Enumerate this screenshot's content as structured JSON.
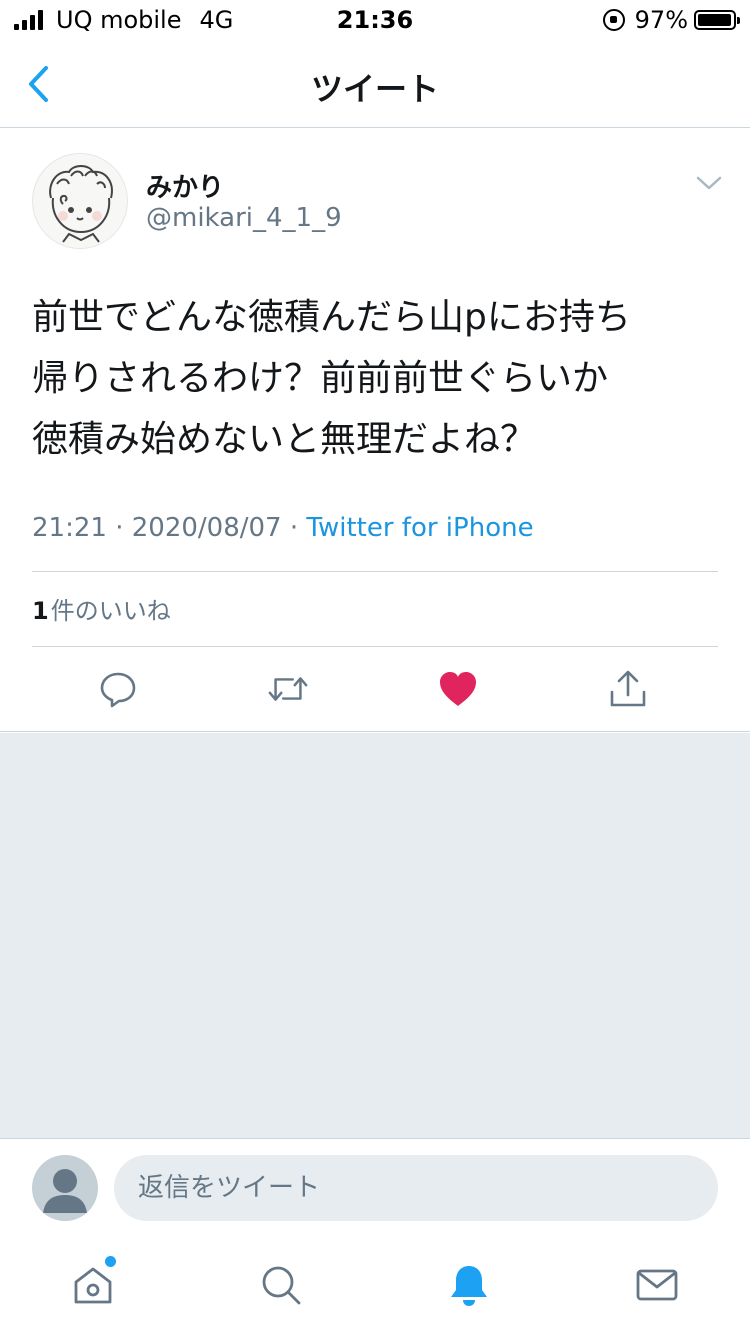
{
  "status_bar": {
    "carrier": "UQ mobile",
    "network": "4G",
    "time": "21:36",
    "battery_percent": "97%",
    "battery_level": 0.97
  },
  "nav": {
    "title": "ツイート",
    "back_icon": "chevron-left-icon"
  },
  "tweet": {
    "author_name": "みかり",
    "author_handle": "@mikari_4_1_9",
    "text_lines": [
      "前世でどんな徳積んだら山pにお持ち",
      "帰りされるわけ？前前前世ぐらいか",
      "徳積み始めないと無理だよね？"
    ],
    "time": "21:21",
    "date": "2020/08/07",
    "separator": " · ",
    "source": "Twitter for iPhone",
    "likes_count": "1",
    "likes_label": "件のいいね",
    "liked": true
  },
  "actions": {
    "reply_icon": "reply-icon",
    "retweet_icon": "retweet-icon",
    "like_icon": "heart-icon",
    "share_icon": "share-icon"
  },
  "reply": {
    "placeholder": "返信をツイート"
  },
  "tabs": [
    {
      "icon": "home-icon",
      "has_dot": true
    },
    {
      "icon": "search-icon"
    },
    {
      "icon": "bell-icon",
      "active": true
    },
    {
      "icon": "mail-icon"
    }
  ],
  "colors": {
    "accent": "#1da1f2",
    "link": "#1b95e0",
    "like": "#e0245e",
    "secondary_text": "#657786",
    "background_empty": "#e6ecf0"
  }
}
